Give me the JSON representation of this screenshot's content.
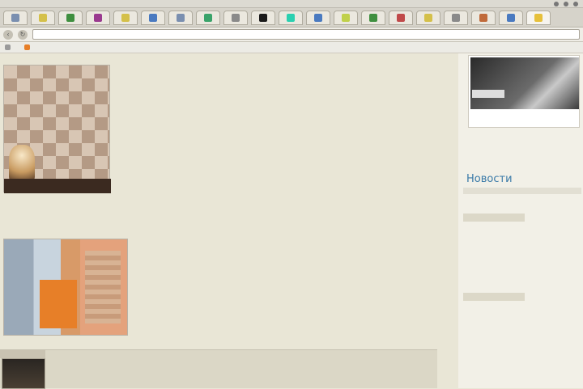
{
  "browser": {
    "menu_items": [
      "",
      "",
      "",
      ""
    ],
    "url": "",
    "bookmarks": [
      "",
      ""
    ]
  },
  "main": {
    "paragraphs": [
      "",
      "",
      "",
      "",
      ""
    ],
    "article_tag": "",
    "article_link": "",
    "article_sub": ""
  },
  "sidebar": {
    "ad_label": "",
    "ad_caption": "",
    "news_title": "Новости",
    "news": [
      {
        "date": "",
        "link": "",
        "text": ""
      },
      {
        "date": "",
        "link": "",
        "text": ""
      }
    ]
  },
  "colors": {
    "link": "#1a44b3",
    "accent": "#3a7aa8",
    "page_bg": "#e9e6d6"
  }
}
